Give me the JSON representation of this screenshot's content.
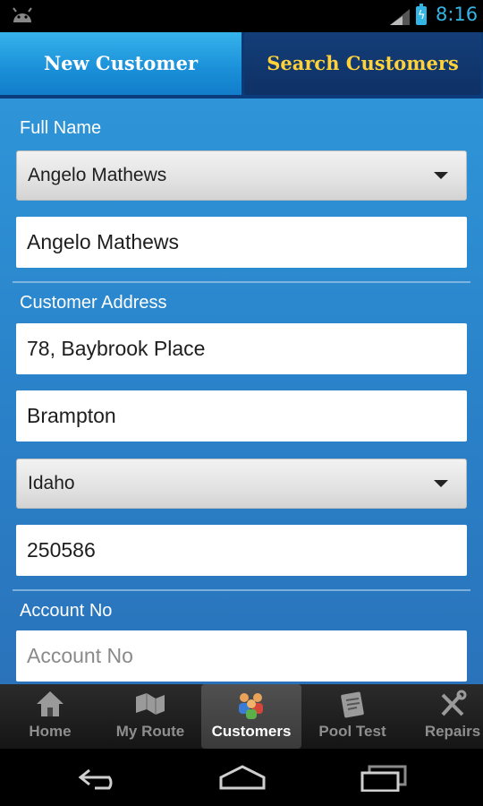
{
  "status_bar": {
    "time": "8:16",
    "icons": [
      "android-icon",
      "signal-icon",
      "battery-charging-icon"
    ]
  },
  "tabs": [
    {
      "label": "New Customer",
      "active": true
    },
    {
      "label": "Search Customers",
      "active": false
    }
  ],
  "form": {
    "full_name_label": "Full Name",
    "name_select_value": "Angelo Mathews",
    "full_name_value": "Angelo Mathews",
    "address_label": "Customer Address",
    "street_value": "78, Baybrook Place",
    "city_value": "Brampton",
    "state_select_value": "Idaho",
    "zip_value": "250586",
    "account_label": "Account No",
    "account_placeholder": "Account No"
  },
  "bottom_tabs": [
    {
      "label": "Home",
      "icon": "home-icon"
    },
    {
      "label": "My Route",
      "icon": "route-icon"
    },
    {
      "label": "Customers",
      "icon": "customers-icon",
      "active": true
    },
    {
      "label": "Pool Test",
      "icon": "pool-test-icon"
    },
    {
      "label": "Repairs",
      "icon": "repairs-icon"
    }
  ],
  "nav_bar": {
    "icons": [
      "back-icon",
      "home-nav-icon",
      "recents-icon"
    ]
  },
  "colors": {
    "accent_blue": "#33b5e5",
    "search_tab_text": "#ffd23a",
    "form_bg": "#2a82c9"
  }
}
